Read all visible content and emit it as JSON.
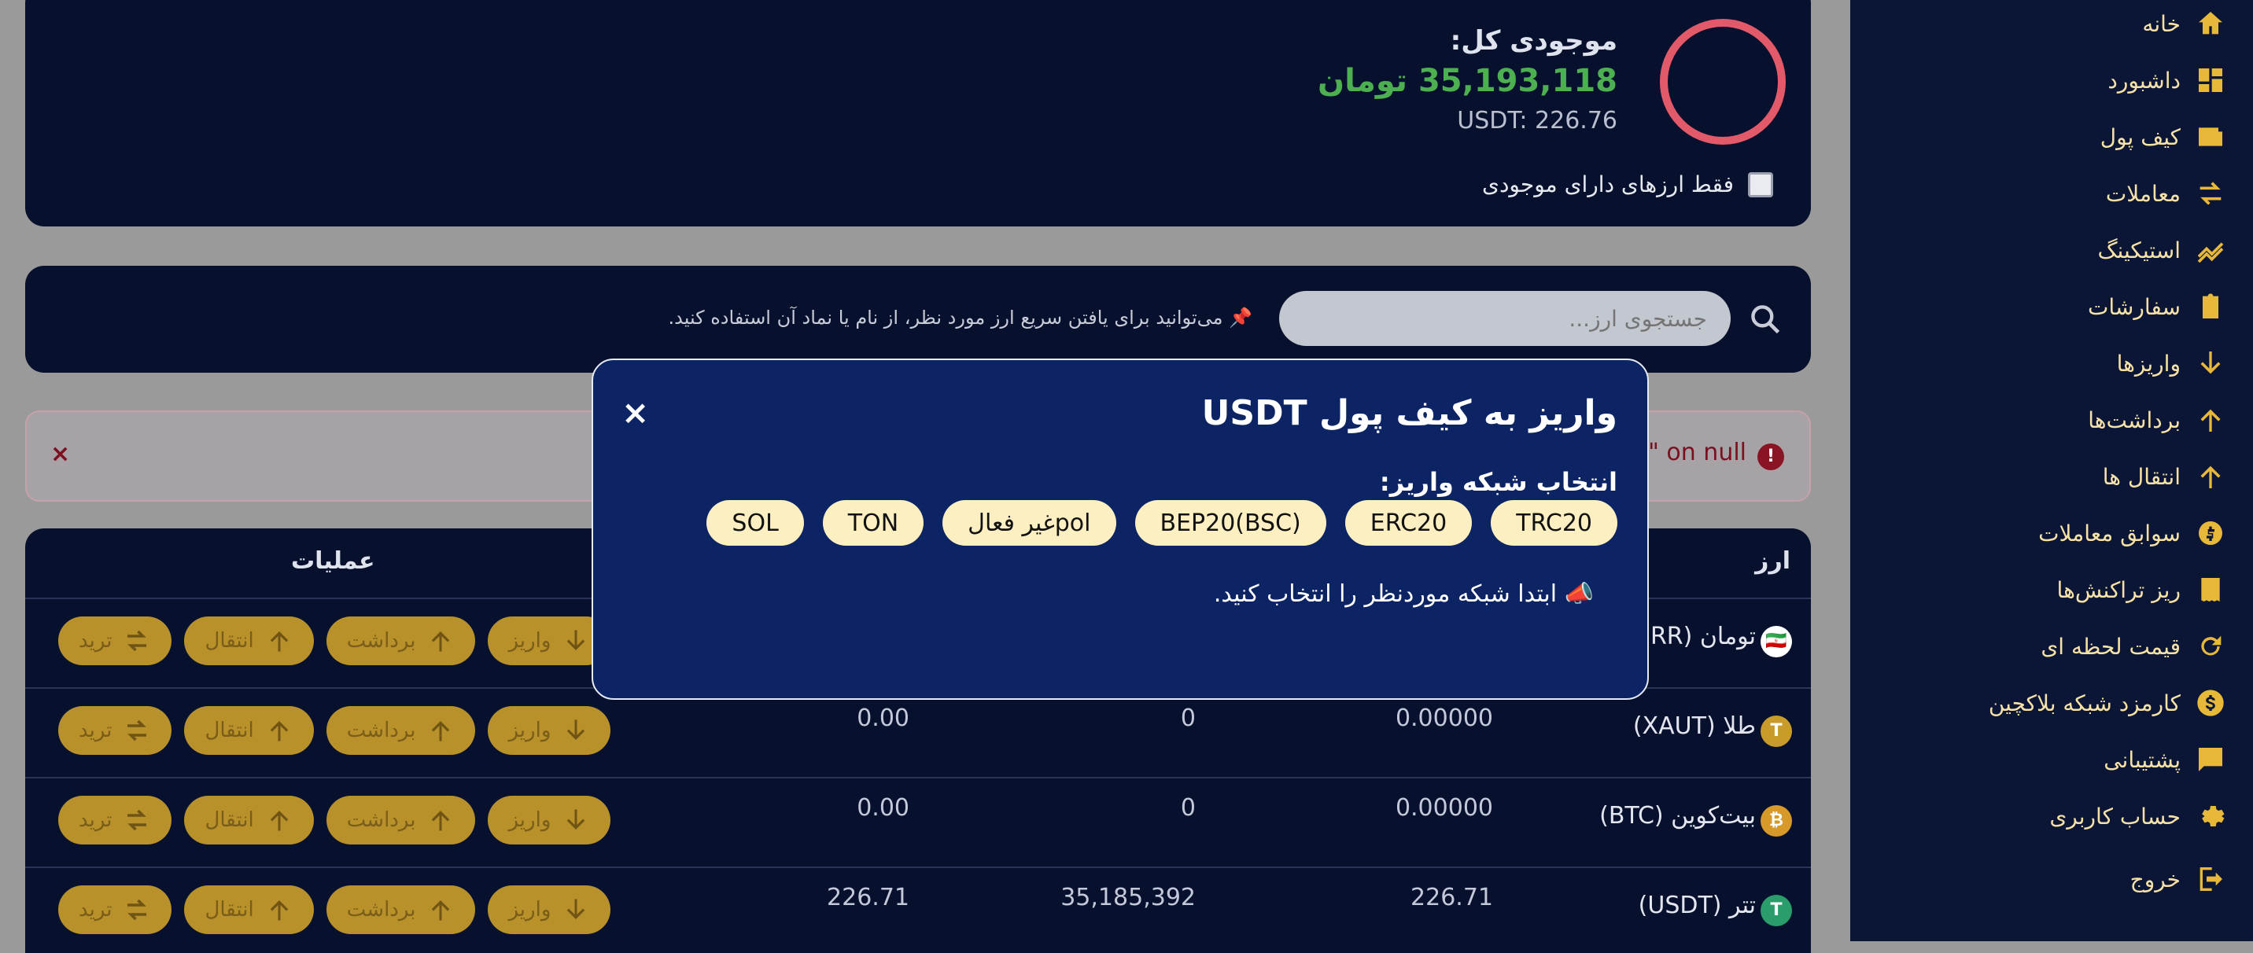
{
  "sidebar": {
    "items": [
      {
        "label": "خانه",
        "icon": "home-icon"
      },
      {
        "label": "داشبورد",
        "icon": "dashboard-icon"
      },
      {
        "label": "کیف پول",
        "icon": "wallet-icon"
      },
      {
        "label": "معاملات",
        "icon": "swap-icon"
      },
      {
        "label": "استیکینگ",
        "icon": "trend-icon"
      },
      {
        "label": "سفارشات",
        "icon": "clipboard-icon"
      },
      {
        "label": "واریزها",
        "icon": "arrow-down-icon"
      },
      {
        "label": "برداشت‌ها",
        "icon": "arrow-up-icon"
      },
      {
        "label": "انتقال ها",
        "icon": "arrow-up-icon"
      },
      {
        "label": "سوابق معاملات",
        "icon": "currency-exchange-icon"
      },
      {
        "label": "ریز تراکنش‌ها",
        "icon": "receipt-icon"
      },
      {
        "label": "قیمت لحظه ای",
        "icon": "refresh-icon"
      },
      {
        "label": "کارمزد شبکه بلاکچین",
        "icon": "dollar-icon"
      },
      {
        "label": "پشتیبانی",
        "icon": "chat-icon"
      },
      {
        "label": "حساب کاربری",
        "icon": "gear-icon"
      },
      {
        "label": "خروج",
        "icon": "logout-icon"
      }
    ]
  },
  "balance": {
    "title": "موجودی کل:",
    "amount": "35,193,118 تومان",
    "usdt": "USDT: 226.76",
    "only_with_balance": "فقط ارزهای دارای موجودی"
  },
  "search": {
    "placeholder": "جستجوی ارز...",
    "hint": "📌 می‌توانید برای یافتن سریع ارز مورد نظر، از نام یا نماد آن استفاده کنید."
  },
  "alert": {
    "text": "\" on null",
    "close": "×",
    "icon": "!"
  },
  "table": {
    "headers": {
      "coin": "ارز",
      "ops": "عملیات"
    },
    "rows": [
      {
        "coin": "تومان (IRR)",
        "icon": "🇮🇷",
        "icon_color": "#ffffff",
        "c1": "",
        "c2": "",
        "c3": ""
      },
      {
        "coin": "طلا (XAUT)",
        "icon": "T",
        "icon_color": "#c89b2a",
        "c1": "0.00000",
        "c2": "0",
        "c3": "0.00"
      },
      {
        "coin": "بیت‌کوین (BTC)",
        "icon": "₿",
        "icon_color": "#d79a2a",
        "c1": "0.00000",
        "c2": "0",
        "c3": "0.00"
      },
      {
        "coin": "تتر (USDT)",
        "icon": "T",
        "icon_color": "#2a9d6a",
        "c1": "226.71",
        "c2": "35,185,392",
        "c3": "226.71"
      }
    ],
    "ops": {
      "deposit": "واریز",
      "withdraw": "برداشت",
      "transfer": "انتقال",
      "trade": "ترید"
    }
  },
  "modal": {
    "title": "واریز به کیف پول USDT",
    "close": "×",
    "network_label": "انتخاب شبکه واریز:",
    "networks": [
      "TRC20",
      "ERC20",
      "BEP20(BSC)",
      "polغیر فعال",
      "TON",
      "SOL"
    ],
    "hint": "📣 ابتدا شبکه موردنظر را انتخاب کنید."
  }
}
